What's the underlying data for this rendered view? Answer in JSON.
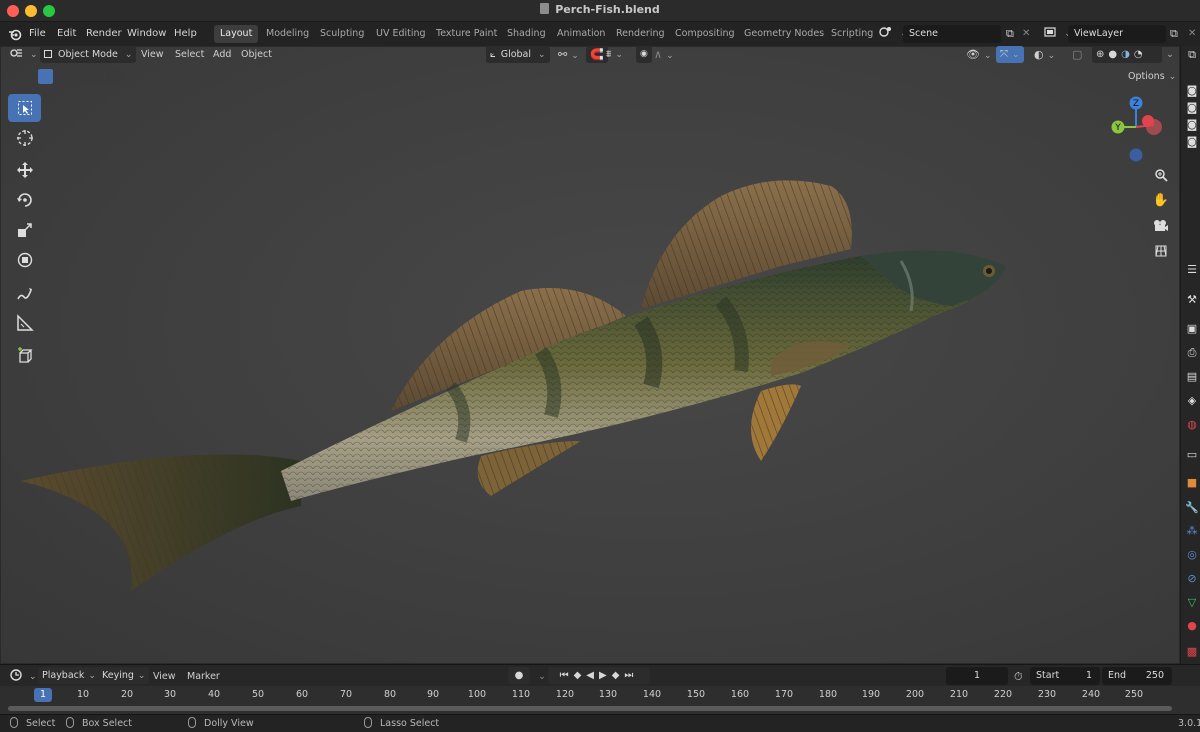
{
  "window": {
    "title": "Perch-Fish.blend"
  },
  "menu": {
    "file": "File",
    "edit": "Edit",
    "render": "Render",
    "window": "Window",
    "help": "Help"
  },
  "workspaces": [
    "Layout",
    "Modeling",
    "Sculpting",
    "UV Editing",
    "Texture Paint",
    "Shading",
    "Animation",
    "Rendering",
    "Compositing",
    "Geometry Nodes",
    "Scripting"
  ],
  "active_workspace": "Layout",
  "scene": {
    "value": "Scene"
  },
  "view_layer": {
    "value": "ViewLayer"
  },
  "viewport_header": {
    "mode": "Object Mode",
    "view": "View",
    "select": "Select",
    "add": "Add",
    "object": "Object",
    "orientation": "Global",
    "options": "Options"
  },
  "gizmo": {
    "z": "Z",
    "y": "Y"
  },
  "timeline": {
    "playback": "Playback",
    "keying": "Keying",
    "view": "View",
    "marker": "Marker",
    "current_frame": "1",
    "start_label": "Start",
    "start": "1",
    "end_label": "End",
    "end": "250",
    "ruler": [
      "1",
      "10",
      "20",
      "30",
      "40",
      "50",
      "60",
      "70",
      "80",
      "90",
      "100",
      "110",
      "120",
      "130",
      "140",
      "150",
      "160",
      "170",
      "180",
      "190",
      "200",
      "210",
      "220",
      "230",
      "240",
      "250"
    ]
  },
  "status": {
    "select": "Select",
    "box_select": "Box Select",
    "dolly_view": "Dolly View",
    "lasso_select": "Lasso Select",
    "version": "3.0.1"
  },
  "colors": {
    "accent": "#4772b3",
    "gizmo_x": "#e0444e",
    "gizmo_y": "#8bc640",
    "gizmo_z": "#3c82dc"
  }
}
